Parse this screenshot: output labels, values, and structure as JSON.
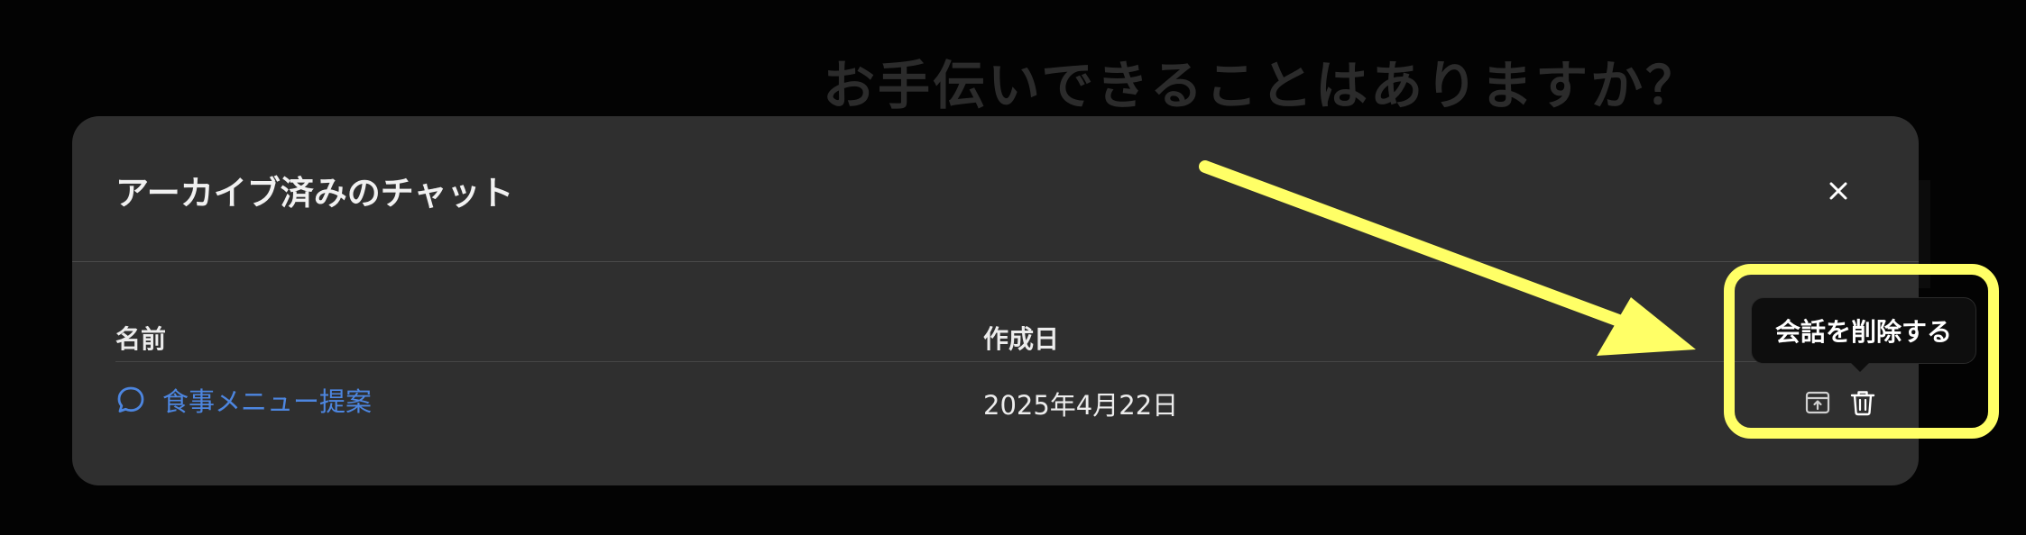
{
  "background": {
    "heading": "お手伝いできることはありますか？"
  },
  "modal": {
    "title": "アーカイブ済みのチャット",
    "close_icon": "close-icon",
    "columns": {
      "name": "名前",
      "created": "作成日"
    },
    "rows": [
      {
        "icon": "chat-bubble-icon",
        "name": "食事メニュー提案",
        "created": "2025年4月22日",
        "actions": [
          "unarchive-icon",
          "trash-icon"
        ]
      }
    ],
    "tooltip": "会話を削除する"
  },
  "annotation": {
    "color": "#ffff66"
  },
  "colors": {
    "modal_bg": "#2f2f2f",
    "link": "#4d86e0",
    "page_bg": "#030303"
  }
}
